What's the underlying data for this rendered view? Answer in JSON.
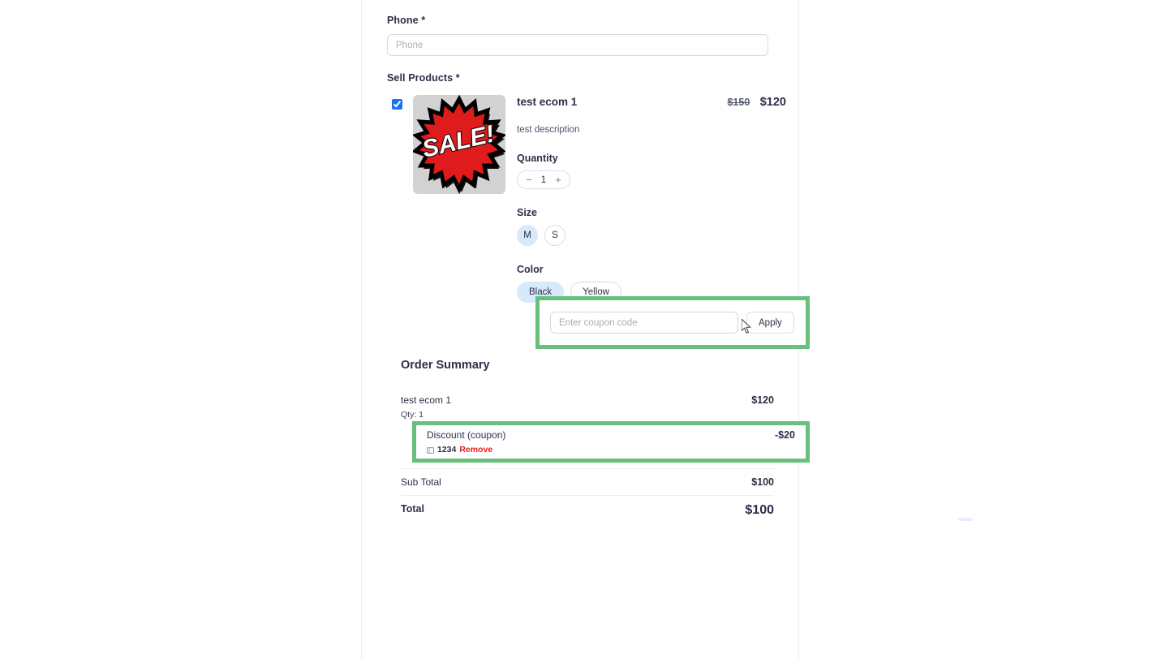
{
  "form": {
    "phone": {
      "label": "Phone *",
      "placeholder": "Phone",
      "value": ""
    },
    "sell_products_label": "Sell Products *"
  },
  "product": {
    "checked": true,
    "image_alt": "SALE!",
    "image_text": "SALE!",
    "title": "test ecom 1",
    "description": "test description",
    "price_original": "$150",
    "price_current": "$120",
    "quantity": {
      "label": "Quantity",
      "decrement": "−",
      "value": "1",
      "increment": "+"
    },
    "size": {
      "label": "Size",
      "options": [
        {
          "label": "M",
          "selected": true
        },
        {
          "label": "S",
          "selected": false
        }
      ]
    },
    "color": {
      "label": "Color",
      "options": [
        {
          "label": "Black",
          "selected": true
        },
        {
          "label": "Yellow",
          "selected": false
        }
      ]
    }
  },
  "coupon": {
    "placeholder": "Enter coupon code",
    "value": "",
    "apply_label": "Apply"
  },
  "order_summary": {
    "title": "Order Summary",
    "item": {
      "name": "test ecom 1",
      "qty_text": "Qty: 1",
      "amount": "$120"
    },
    "discount": {
      "label": "Discount (coupon)",
      "amount": "-$20",
      "code": "1234",
      "remove_label": "Remove"
    },
    "subtotal": {
      "label": "Sub Total",
      "amount": "$100"
    },
    "total": {
      "label": "Total",
      "amount": "$100"
    }
  },
  "colors": {
    "highlight_green": "#68c07c",
    "accent_blue": "#1a73f0",
    "chip_selected": "#d7e9fa",
    "remove_red": "#f01a1a",
    "text": "#2c3047"
  }
}
